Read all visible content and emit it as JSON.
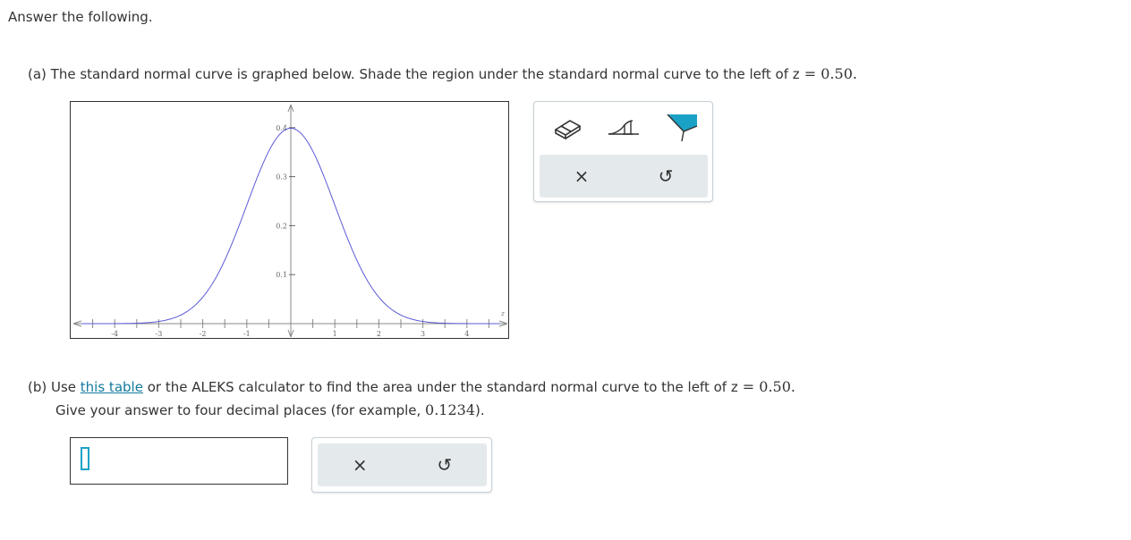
{
  "intro": "Answer the following.",
  "part_a": {
    "text": "(a) The standard normal curve is graphed below. Shade the region under the standard normal curve to the left of ",
    "z_var": "z",
    "eq": " = ",
    "z_value": "0.50",
    "end": "."
  },
  "graph": {
    "x_ticks": [
      "-4",
      "-3",
      "-2",
      "-1",
      "1",
      "2",
      "3",
      "4"
    ],
    "y_ticks": [
      "0.4",
      "0.3",
      "0.2",
      "0.1"
    ],
    "axis_label": "z",
    "curve_color": "#5b5bd6"
  },
  "tools": {
    "eraser": "eraser-icon",
    "shade_between": "shade-between-icon",
    "shade_left": "shade-left-icon",
    "clear": "×",
    "undo": "↺",
    "accent": "#1aa2c6"
  },
  "part_b": {
    "prefix": "(b) Use ",
    "link": "this table",
    "text": " or the ALEKS calculator to find the area under the standard normal curve to the left of ",
    "z_var": "z",
    "eq": " = ",
    "z_value": "0.50",
    "end": ".",
    "line2_prefix": "Give your answer to four decimal places (for example, ",
    "example": "0.1234",
    "line2_end": ")."
  },
  "answer": {
    "clear": "×",
    "undo": "↺"
  }
}
